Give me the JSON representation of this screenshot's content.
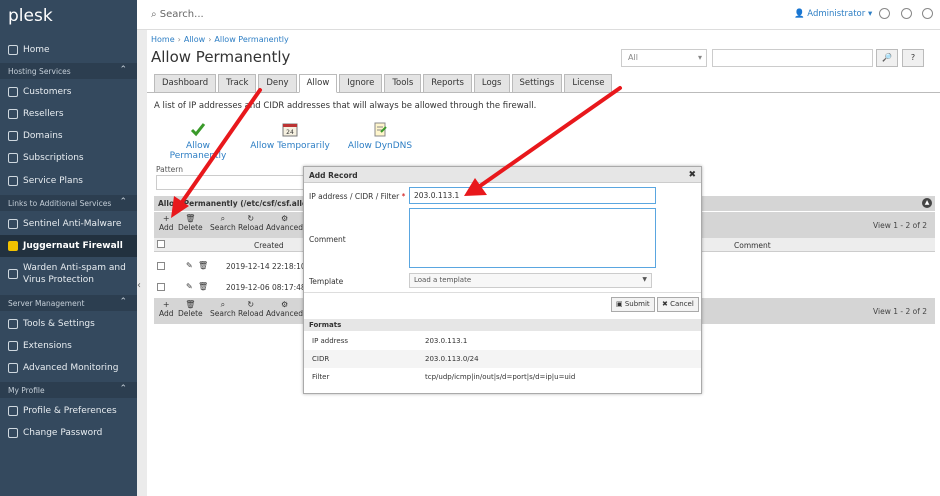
{
  "brand": {
    "logo": "plesk"
  },
  "sidebar": {
    "home": "Home",
    "hosting_section": "Hosting Services",
    "hosting_items": [
      "Customers",
      "Resellers",
      "Domains",
      "Subscriptions",
      "Service Plans"
    ],
    "links_section": "Links to Additional Services",
    "links_items": [
      "Sentinel Anti-Malware",
      "Juggernaut Firewall",
      "Warden Anti-spam and",
      "Virus Protection"
    ],
    "server_section": "Server Management",
    "server_items": [
      "Tools & Settings",
      "Extensions",
      "Advanced Monitoring"
    ],
    "profile_section": "My Profile",
    "profile_items": [
      "Profile & Preferences",
      "Change Password"
    ]
  },
  "topbar": {
    "search_placeholder": "Search...",
    "user": "Administrator"
  },
  "breadcrumb": [
    "Home",
    "Allow",
    "Allow Permanently"
  ],
  "page_title": "Allow Permanently",
  "filter": {
    "select_value": "All",
    "search_btn": "🔎",
    "help_btn": "?"
  },
  "tabs": [
    "Dashboard",
    "Track",
    "Deny",
    "Allow",
    "Ignore",
    "Tools",
    "Reports",
    "Logs",
    "Settings",
    "License"
  ],
  "description": "A list of IP addresses and CIDR addresses that will always be allowed through the firewall.",
  "actions": [
    "Allow Permanently",
    "Allow Temporarily",
    "Allow DynDNS"
  ],
  "pattern_label": "Pattern",
  "panel": {
    "title": "Allow Permanently (/etc/csf/csf.allow)",
    "toolbar": [
      "Add",
      "Delete",
      "Search",
      "Reload",
      "Advanced"
    ],
    "view_count": "View 1 - 2 of 2",
    "col_created": "Created",
    "col_comment": "Comment",
    "rows": [
      {
        "created": "2019-12-14 22:18:10"
      },
      {
        "created": "2019-12-06 08:17:48"
      }
    ]
  },
  "modal": {
    "title": "Add Record",
    "ip_label": "IP address / CIDR / Filter",
    "required_mark": "*",
    "ip_value": "203.0.113.1",
    "comment_label": "Comment",
    "template_label": "Template",
    "template_value": "Load a template",
    "submit": "Submit",
    "cancel": "Cancel",
    "formats_title": "Formats",
    "formats": [
      {
        "k": "IP address",
        "v": "203.0.113.1"
      },
      {
        "k": "CIDR",
        "v": "203.0.113.0/24"
      },
      {
        "k": "Filter",
        "v": "tcp/udp/icmp|in/out|s/d=port|s/d=ip|u=uid"
      }
    ]
  },
  "colors": {
    "sidebar": "#34495e",
    "link": "#2d7ec4",
    "arrow": "#e8181c"
  }
}
